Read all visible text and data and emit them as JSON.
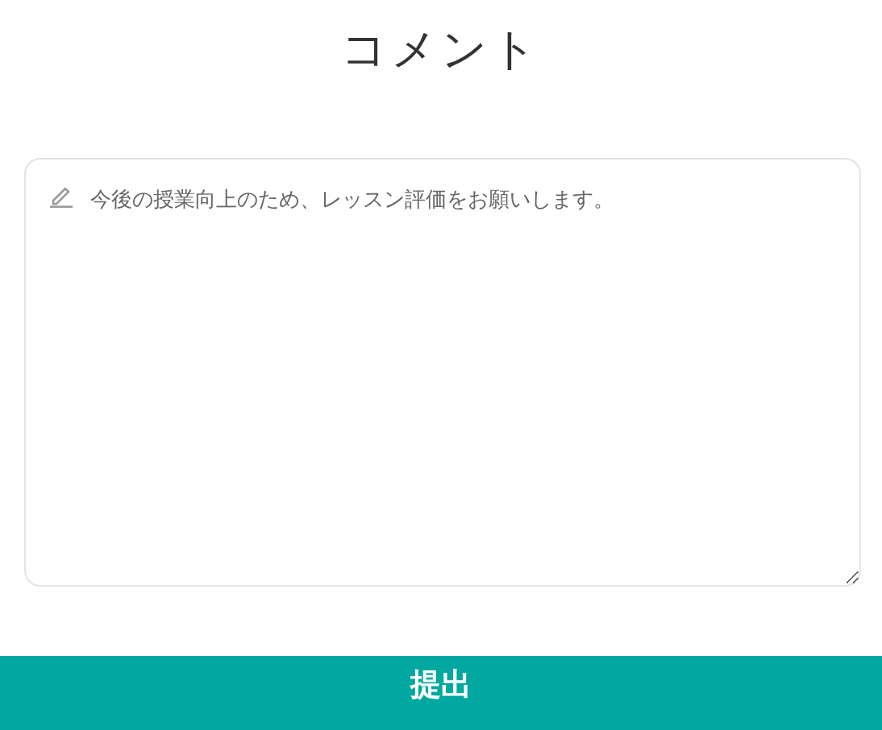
{
  "title": "コメント",
  "comment": {
    "placeholder": "今後の授業向上のため、レッスン評価をお願いします。"
  },
  "submit_button": {
    "label": "提出"
  }
}
